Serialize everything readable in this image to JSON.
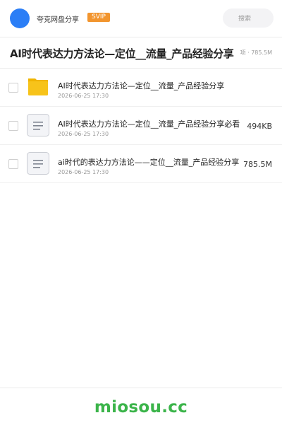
{
  "header": {
    "username": "夸克网盘分享",
    "badge": "SVIP",
    "search_label": "搜索"
  },
  "title_row": {
    "title": "AI时代表达力方法论—定位__流量_产品经验分享",
    "meta": "项 · 785.5M"
  },
  "files": [
    {
      "type": "folder",
      "icon": "folder-icon",
      "name": "AI时代表达力方法论—定位__流量_产品经验分享",
      "date": "2026-06-25 17:30",
      "size": ""
    },
    {
      "type": "document",
      "icon": "document-icon",
      "name": "AI时代表达力方法论—定位__流量_产品经验分享必看",
      "date": "2026-06-25 17:30",
      "size": "494KB"
    },
    {
      "type": "document",
      "icon": "document-icon",
      "name": "ai时代的表达力方法论——定位__流量_产品经验分享",
      "date": "2026-06-25 17:30",
      "size": "785.5M"
    }
  ],
  "footer": {
    "brand": "miosou.cc"
  },
  "colors": {
    "avatar": "#2b7ef6",
    "badge": "#f2952e",
    "folder": "#f7c31a",
    "brand": "#3bb44a"
  }
}
